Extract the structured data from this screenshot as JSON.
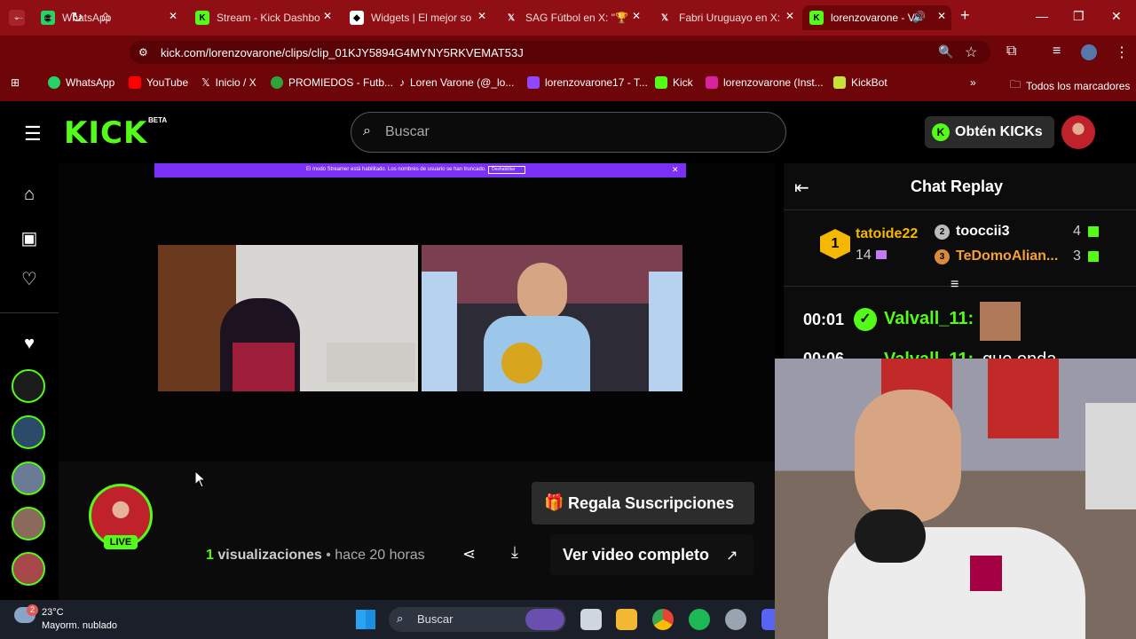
{
  "browser": {
    "tabs": [
      {
        "title": "WhatsApp",
        "color": "#25d366"
      },
      {
        "title": "Stream - Kick Dashbo",
        "color": "#53fc18"
      },
      {
        "title": "Widgets | El mejor so",
        "color": "#ffffff"
      },
      {
        "title": "SAG Fútbol en X: \"🏆",
        "color": "#ffffff"
      },
      {
        "title": "Fabri Uruguayo en X:",
        "color": "#ffffff"
      },
      {
        "title": "lorenzovarone - V",
        "color": "#53fc18"
      }
    ],
    "url": "kick.com/lorenzovarone/clips/clip_01KJY5894G4MYNY5RKVEMAT53J",
    "bookmarks": [
      "WhatsApp",
      "YouTube",
      "Inicio / X",
      "PROMIEDOS - Futb...",
      "Loren Varone (@_lo...",
      "lorenzovarone17 - T...",
      "Kick",
      "lorenzovarone (Inst...",
      "KickBot"
    ],
    "bookmark_folder": "Todos los marcadores"
  },
  "kick": {
    "logo": "KICK",
    "beta": "BETA",
    "search_placeholder": "Buscar",
    "get_kicks": "Obtén KICKs",
    "accent": "#53fc18",
    "banner_text": "El modo Streamer está habilitado. Los nombres de usuario se han truncado.",
    "banner_button": "Deshabilitar",
    "live": "LIVE",
    "gift_button": "Regala Suscripciones",
    "views_count": "1",
    "views_label": "visualizaciones",
    "separator": "•",
    "time_ago": "hace 20 horas",
    "full_video": "Ver video completo"
  },
  "chat": {
    "title": "Chat Replay",
    "leaderboard": [
      {
        "rank": "1",
        "name": "tatoide22",
        "count": "14"
      },
      {
        "rank": "2",
        "name": "tooccii3",
        "count": "4"
      },
      {
        "rank": "3",
        "name": "TeDomoAlian...",
        "count": "3"
      }
    ],
    "messages": [
      {
        "time": "00:01",
        "user": "Valvall_11:",
        "text": ""
      },
      {
        "time": "00:06",
        "user": "Valvall_11:",
        "text": "que onda"
      }
    ]
  },
  "taskbar": {
    "temp": "23°C",
    "weather": "Mayorm. nublado",
    "badge": "2",
    "search": "Buscar"
  }
}
